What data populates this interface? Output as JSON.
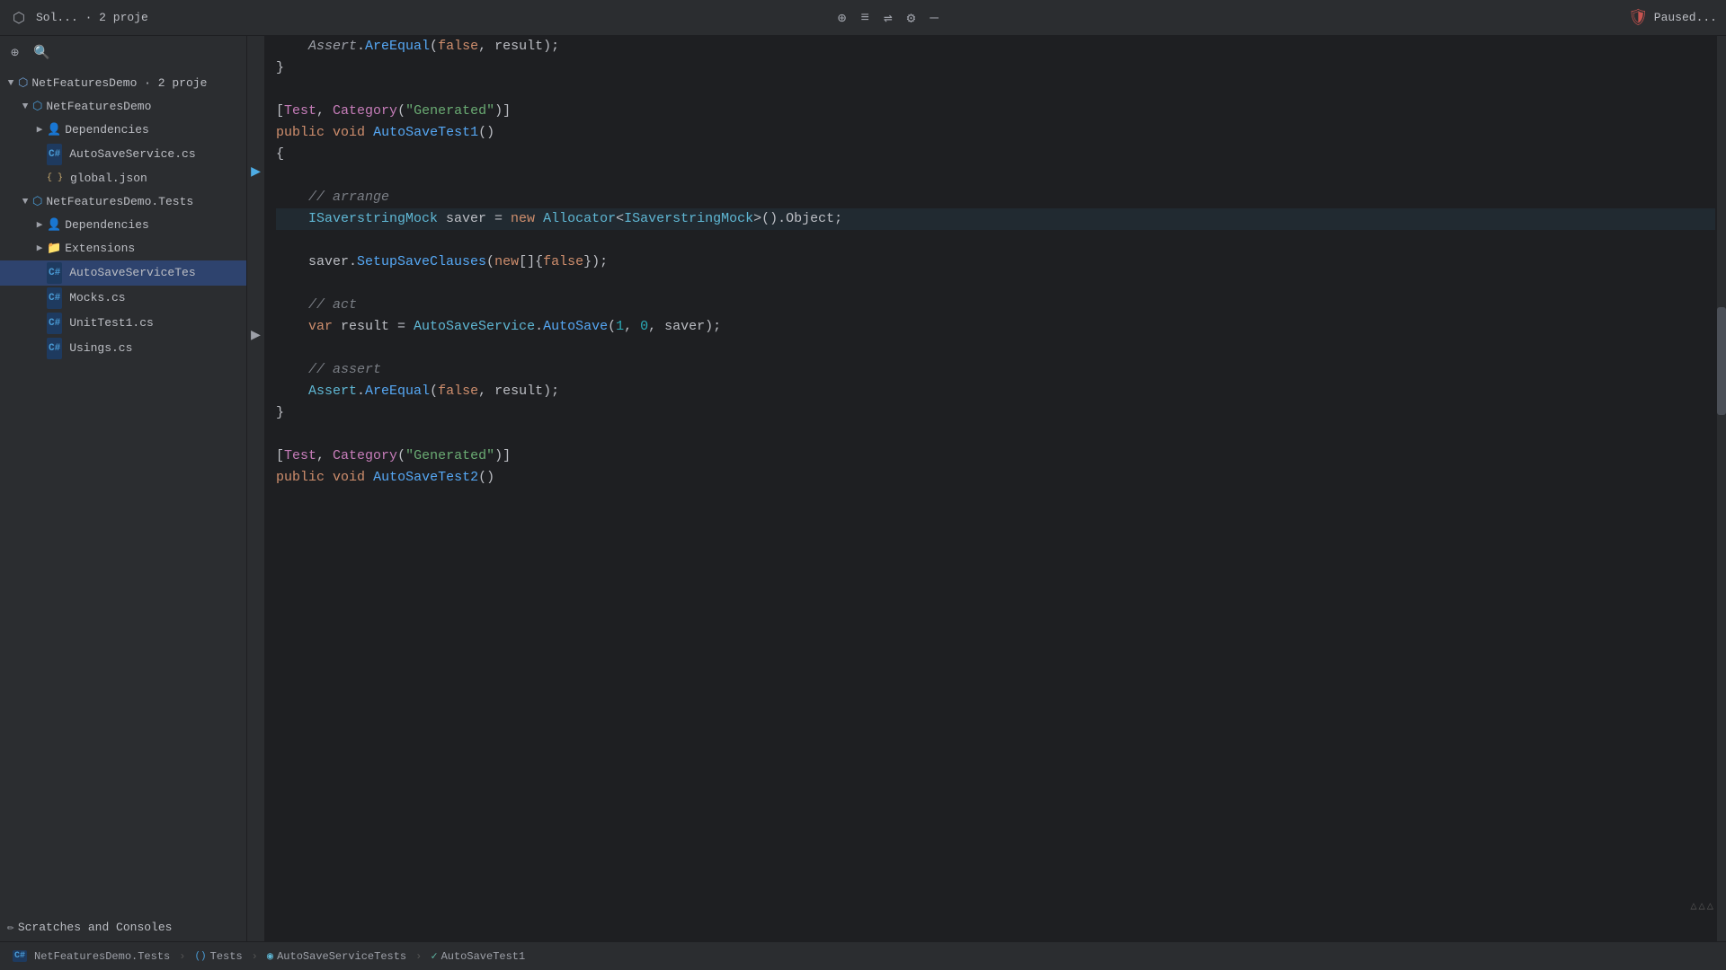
{
  "toolbar": {
    "title": "Sol... · 2 proje",
    "icons": [
      "solution-icon",
      "add-icon",
      "align-icon",
      "align2-icon",
      "gear-icon",
      "minimize-icon"
    ],
    "paused_label": "Paused...",
    "sidebar_icons": [
      "add-root-icon",
      "search-icon"
    ]
  },
  "sidebar": {
    "solution_label": "NetFeaturesDemo · 2 proje",
    "project1": {
      "label": "NetFeaturesDemo",
      "children": [
        {
          "label": "Dependencies",
          "type": "deps"
        },
        {
          "label": "AutoSaveService.cs",
          "type": "csharp"
        },
        {
          "label": "global.json",
          "type": "json"
        }
      ]
    },
    "project2": {
      "label": "NetFeaturesDemo.Tests",
      "children": [
        {
          "label": "Dependencies",
          "type": "deps"
        },
        {
          "label": "Extensions",
          "type": "folder"
        },
        {
          "label": "AutoSaveServiceTes",
          "type": "csharp",
          "selected": true
        },
        {
          "label": "Mocks.cs",
          "type": "csharp"
        },
        {
          "label": "UnitTest1.cs",
          "type": "csharp"
        },
        {
          "label": "Usings.cs",
          "type": "csharp"
        }
      ]
    },
    "scratches_label": "Scratches and Consoles"
  },
  "code": {
    "lines": [
      {
        "content": "    Assert.AreEqual(false, result);",
        "tokens": [
          {
            "t": "plain",
            "v": "    "
          },
          {
            "t": "type",
            "v": "Assert"
          },
          {
            "t": "punct",
            "v": "."
          },
          {
            "t": "method",
            "v": "AreEqual"
          },
          {
            "t": "punct",
            "v": "("
          },
          {
            "t": "kw",
            "v": "false"
          },
          {
            "t": "punct",
            "v": ", result);"
          }
        ]
      },
      {
        "content": "}",
        "tokens": [
          {
            "t": "plain",
            "v": "}"
          }
        ]
      },
      {
        "content": "",
        "tokens": []
      },
      {
        "content": "[Test, Category(\"Generated\")]",
        "tokens": [
          {
            "t": "punct",
            "v": "["
          },
          {
            "t": "attr",
            "v": "Test"
          },
          {
            "t": "punct",
            "v": ", "
          },
          {
            "t": "attr",
            "v": "Category"
          },
          {
            "t": "punct",
            "v": "("
          },
          {
            "t": "string",
            "v": "\"Generated\""
          },
          {
            "t": "punct",
            "v": ")]"
          }
        ]
      },
      {
        "content": "public void AutoSaveTest1()",
        "tokens": [
          {
            "t": "kw",
            "v": "public"
          },
          {
            "t": "plain",
            "v": " "
          },
          {
            "t": "kw",
            "v": "void"
          },
          {
            "t": "plain",
            "v": " "
          },
          {
            "t": "method",
            "v": "AutoSaveTest1"
          },
          {
            "t": "punct",
            "v": "()"
          }
        ],
        "has_green_check": true
      },
      {
        "content": "{",
        "tokens": [
          {
            "t": "plain",
            "v": "{"
          }
        ]
      },
      {
        "content": "",
        "tokens": []
      },
      {
        "content": "    // arrange",
        "tokens": [
          {
            "t": "comment",
            "v": "    // arrange"
          }
        ]
      },
      {
        "content": "    ISaverstringMock saver = new Allocator<ISaverstringMock>().Object;",
        "tokens": [
          {
            "t": "plain",
            "v": "    "
          },
          {
            "t": "type",
            "v": "ISaverstringMock"
          },
          {
            "t": "plain",
            "v": " saver = "
          },
          {
            "t": "kw",
            "v": "new"
          },
          {
            "t": "plain",
            "v": " "
          },
          {
            "t": "type",
            "v": "Allocator"
          },
          {
            "t": "punct",
            "v": "<"
          },
          {
            "t": "type",
            "v": "ISaverstringMock"
          },
          {
            "t": "punct",
            "v": ">()."
          },
          {
            "t": "plain",
            "v": "Object;"
          }
        ],
        "has_debug_pointer": true
      },
      {
        "content": "    saver.SetupSaveClauses(new[]{false});",
        "tokens": [
          {
            "t": "plain",
            "v": "    saver."
          },
          {
            "t": "method",
            "v": "SetupSaveClauses"
          },
          {
            "t": "punct",
            "v": "("
          },
          {
            "t": "kw",
            "v": "new"
          },
          {
            "t": "punct",
            "v": "[]{"
          },
          {
            "t": "kw",
            "v": "false"
          },
          {
            "t": "punct",
            "v": "});"
          }
        ]
      },
      {
        "content": "",
        "tokens": []
      },
      {
        "content": "    // act",
        "tokens": [
          {
            "t": "comment",
            "v": "    // act"
          }
        ]
      },
      {
        "content": "    var result = AutoSaveService.AutoSave(1, 0, saver);",
        "tokens": [
          {
            "t": "plain",
            "v": "    "
          },
          {
            "t": "kw",
            "v": "var"
          },
          {
            "t": "plain",
            "v": " result = "
          },
          {
            "t": "type",
            "v": "AutoSaveService"
          },
          {
            "t": "punct",
            "v": "."
          },
          {
            "t": "method",
            "v": "AutoSave"
          },
          {
            "t": "punct",
            "v": "("
          },
          {
            "t": "num",
            "v": "1"
          },
          {
            "t": "punct",
            "v": ", "
          },
          {
            "t": "num",
            "v": "0"
          },
          {
            "t": "punct",
            "v": ", saver);"
          }
        ]
      },
      {
        "content": "",
        "tokens": []
      },
      {
        "content": "    // assert",
        "tokens": [
          {
            "t": "comment",
            "v": "    // assert"
          }
        ]
      },
      {
        "content": "    Assert.AreEqual(false, result);",
        "tokens": [
          {
            "t": "plain",
            "v": "    "
          },
          {
            "t": "type",
            "v": "Assert"
          },
          {
            "t": "punct",
            "v": "."
          },
          {
            "t": "method",
            "v": "AreEqual"
          },
          {
            "t": "punct",
            "v": "("
          },
          {
            "t": "kw",
            "v": "false"
          },
          {
            "t": "plain",
            "v": ", result);"
          }
        ]
      },
      {
        "content": "}",
        "tokens": [
          {
            "t": "plain",
            "v": "}"
          }
        ]
      },
      {
        "content": "",
        "tokens": []
      },
      {
        "content": "[Test, Category(\"Generated\")]",
        "tokens": [
          {
            "t": "punct",
            "v": "["
          },
          {
            "t": "attr",
            "v": "Test"
          },
          {
            "t": "punct",
            "v": ", "
          },
          {
            "t": "attr",
            "v": "Category"
          },
          {
            "t": "punct",
            "v": "("
          },
          {
            "t": "string",
            "v": "\"Generated\""
          },
          {
            "t": "punct",
            "v": ")]"
          }
        ]
      },
      {
        "content": "public void AutoSaveTest2()",
        "tokens": [
          {
            "t": "kw",
            "v": "public"
          },
          {
            "t": "plain",
            "v": " "
          },
          {
            "t": "kw",
            "v": "void"
          },
          {
            "t": "plain",
            "v": " "
          },
          {
            "t": "method",
            "v": "AutoSaveTest2"
          },
          {
            "t": "punct",
            "v": "()"
          }
        ],
        "has_green_check": true,
        "partial": true
      }
    ]
  },
  "bottom_bar": {
    "project_icon": "csharp-icon",
    "project_label": "NetFeaturesDemo.Tests",
    "separator1": "›",
    "tests_icon": "test-icon",
    "tests_label": "Tests",
    "separator2": "›",
    "class_icon": "class-icon",
    "class_label": "AutoSaveServiceTests",
    "separator3": "›",
    "method_icon": "method-icon",
    "method_label": "AutoSaveTest1"
  },
  "rrr_indicator": "△△△"
}
